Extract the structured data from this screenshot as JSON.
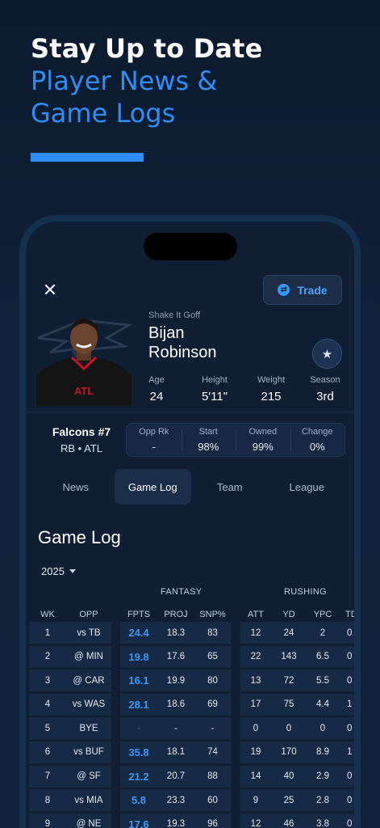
{
  "hero": {
    "line1": "Stay Up to Date",
    "line2": "Player News &",
    "line3": "Game Logs"
  },
  "colors": {
    "accent": "#2f8ef5",
    "background": "#0f1e33",
    "card": "#172a45"
  },
  "header": {
    "close_icon": "close-icon",
    "trade_label": "Trade",
    "trade_icon": "trade-arrows-icon"
  },
  "player": {
    "team_name": "Shake It Goff",
    "first_name": "Bijan",
    "last_name": "Robinson",
    "bio": [
      {
        "label": "Age",
        "value": "24"
      },
      {
        "label": "Height",
        "value": "5'11\""
      },
      {
        "label": "Weight",
        "value": "215"
      },
      {
        "label": "Season",
        "value": "3rd"
      }
    ],
    "franchise": "Falcons #7",
    "position_team": "RB • ATL",
    "stats": [
      {
        "label": "Opp Rk",
        "value": "-"
      },
      {
        "label": "Start",
        "value": "98%"
      },
      {
        "label": "Owned",
        "value": "99%"
      },
      {
        "label": "Change",
        "value": "0%"
      }
    ]
  },
  "tabs": [
    "News",
    "Game Log",
    "Team",
    "League"
  ],
  "active_tab": "Game Log",
  "gamelog": {
    "title": "Game Log",
    "season": "2025",
    "groups": [
      "FANTASY",
      "RUSHING"
    ],
    "columns": [
      "WK",
      "OPP",
      "FPTS",
      "PROJ",
      "SNP%",
      "ATT",
      "YD",
      "YPC",
      "TD"
    ],
    "rows": [
      {
        "wk": "1",
        "opp": "vs TB",
        "fpts": "24.4",
        "proj": "18.3",
        "snp": "83",
        "att": "12",
        "yd": "24",
        "ypc": "2",
        "td": "0"
      },
      {
        "wk": "2",
        "opp": "@ MIN",
        "fpts": "19.8",
        "proj": "17.6",
        "snp": "65",
        "att": "22",
        "yd": "143",
        "ypc": "6.5",
        "td": "0"
      },
      {
        "wk": "3",
        "opp": "@ CAR",
        "fpts": "16.1",
        "proj": "19.9",
        "snp": "80",
        "att": "13",
        "yd": "72",
        "ypc": "5.5",
        "td": "0"
      },
      {
        "wk": "4",
        "opp": "vs WAS",
        "fpts": "28.1",
        "proj": "18.6",
        "snp": "69",
        "att": "17",
        "yd": "75",
        "ypc": "4.4",
        "td": "1"
      },
      {
        "wk": "5",
        "opp": "BYE",
        "fpts": "-",
        "proj": "-",
        "snp": "-",
        "att": "0",
        "yd": "0",
        "ypc": "0",
        "td": "0"
      },
      {
        "wk": "6",
        "opp": "vs BUF",
        "fpts": "35.8",
        "proj": "18.1",
        "snp": "74",
        "att": "19",
        "yd": "170",
        "ypc": "8.9",
        "td": "1"
      },
      {
        "wk": "7",
        "opp": "@ SF",
        "fpts": "21.2",
        "proj": "20.7",
        "snp": "88",
        "att": "14",
        "yd": "40",
        "ypc": "2.9",
        "td": "0"
      },
      {
        "wk": "8",
        "opp": "vs MIA",
        "fpts": "5.8",
        "proj": "23.3",
        "snp": "60",
        "att": "9",
        "yd": "25",
        "ypc": "2.8",
        "td": "0"
      },
      {
        "wk": "9",
        "opp": "@ NE",
        "fpts": "17.6",
        "proj": "19.3",
        "snp": "96",
        "att": "12",
        "yd": "46",
        "ypc": "3.8",
        "td": "0"
      }
    ]
  }
}
